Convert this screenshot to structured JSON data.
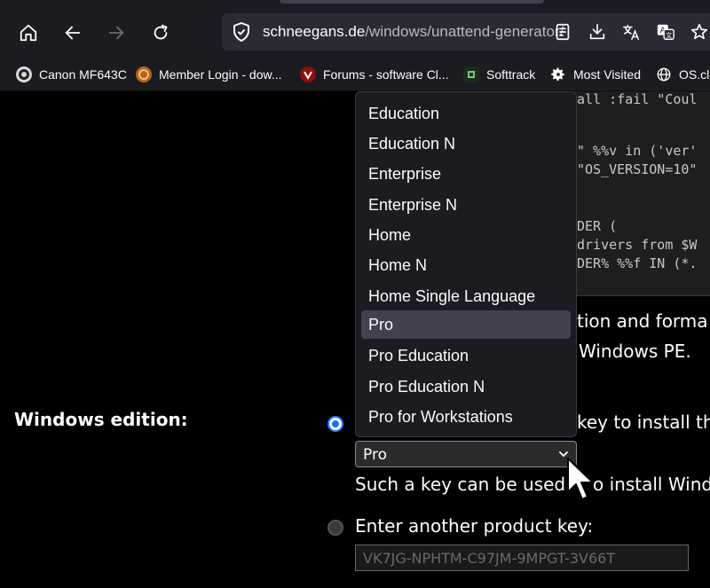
{
  "browser": {
    "url_host": "schneegans.de",
    "url_path": "/windows/unattend-generator/",
    "nav": {
      "home": "home-icon",
      "back": "back-arrow-icon",
      "forward": "forward-arrow-icon",
      "reload": "reload-icon"
    }
  },
  "bookmarks": [
    {
      "label": "Canon MF643C",
      "icon": "canon-favicon"
    },
    {
      "label": "Member Login - dow...",
      "icon": "member-favicon"
    },
    {
      "label": "Forums - software Cl...",
      "icon": "forums-favicon"
    },
    {
      "label": "Softtrack",
      "icon": "softtrack-favicon"
    },
    {
      "label": "Most Visited",
      "icon": "gear-icon"
    },
    {
      "label": "OS.cli",
      "icon": "globe-icon"
    }
  ],
  "code_lines": [
    "all :fail \"Coul",
    "",
    "\" %%v in ('ver'",
    "\"OS_VERSION=10\"",
    "",
    "",
    "DER (",
    "drivers from $W",
    "DER% %%f IN (*."
  ],
  "description_fragments": {
    "line1": "tion and forma",
    "line2": "Windows PE."
  },
  "edition_section": {
    "label": "Windows edition:",
    "option1_text_tail": "key to install th",
    "selected_value": "Pro",
    "hint_left": "Such a key can be used",
    "hint_right": "o install Windo",
    "option2_label": "Enter another product key:",
    "product_key_placeholder": "VK7JG-NPHTM-C97JM-9MPGT-3V66T"
  },
  "dropdown": {
    "items": [
      "Education",
      "Education N",
      "Enterprise",
      "Enterprise N",
      "Home",
      "Home N",
      "Home Single Language",
      "Pro",
      "Pro Education",
      "Pro Education N",
      "Pro for Workstations"
    ],
    "selected": "Pro"
  }
}
